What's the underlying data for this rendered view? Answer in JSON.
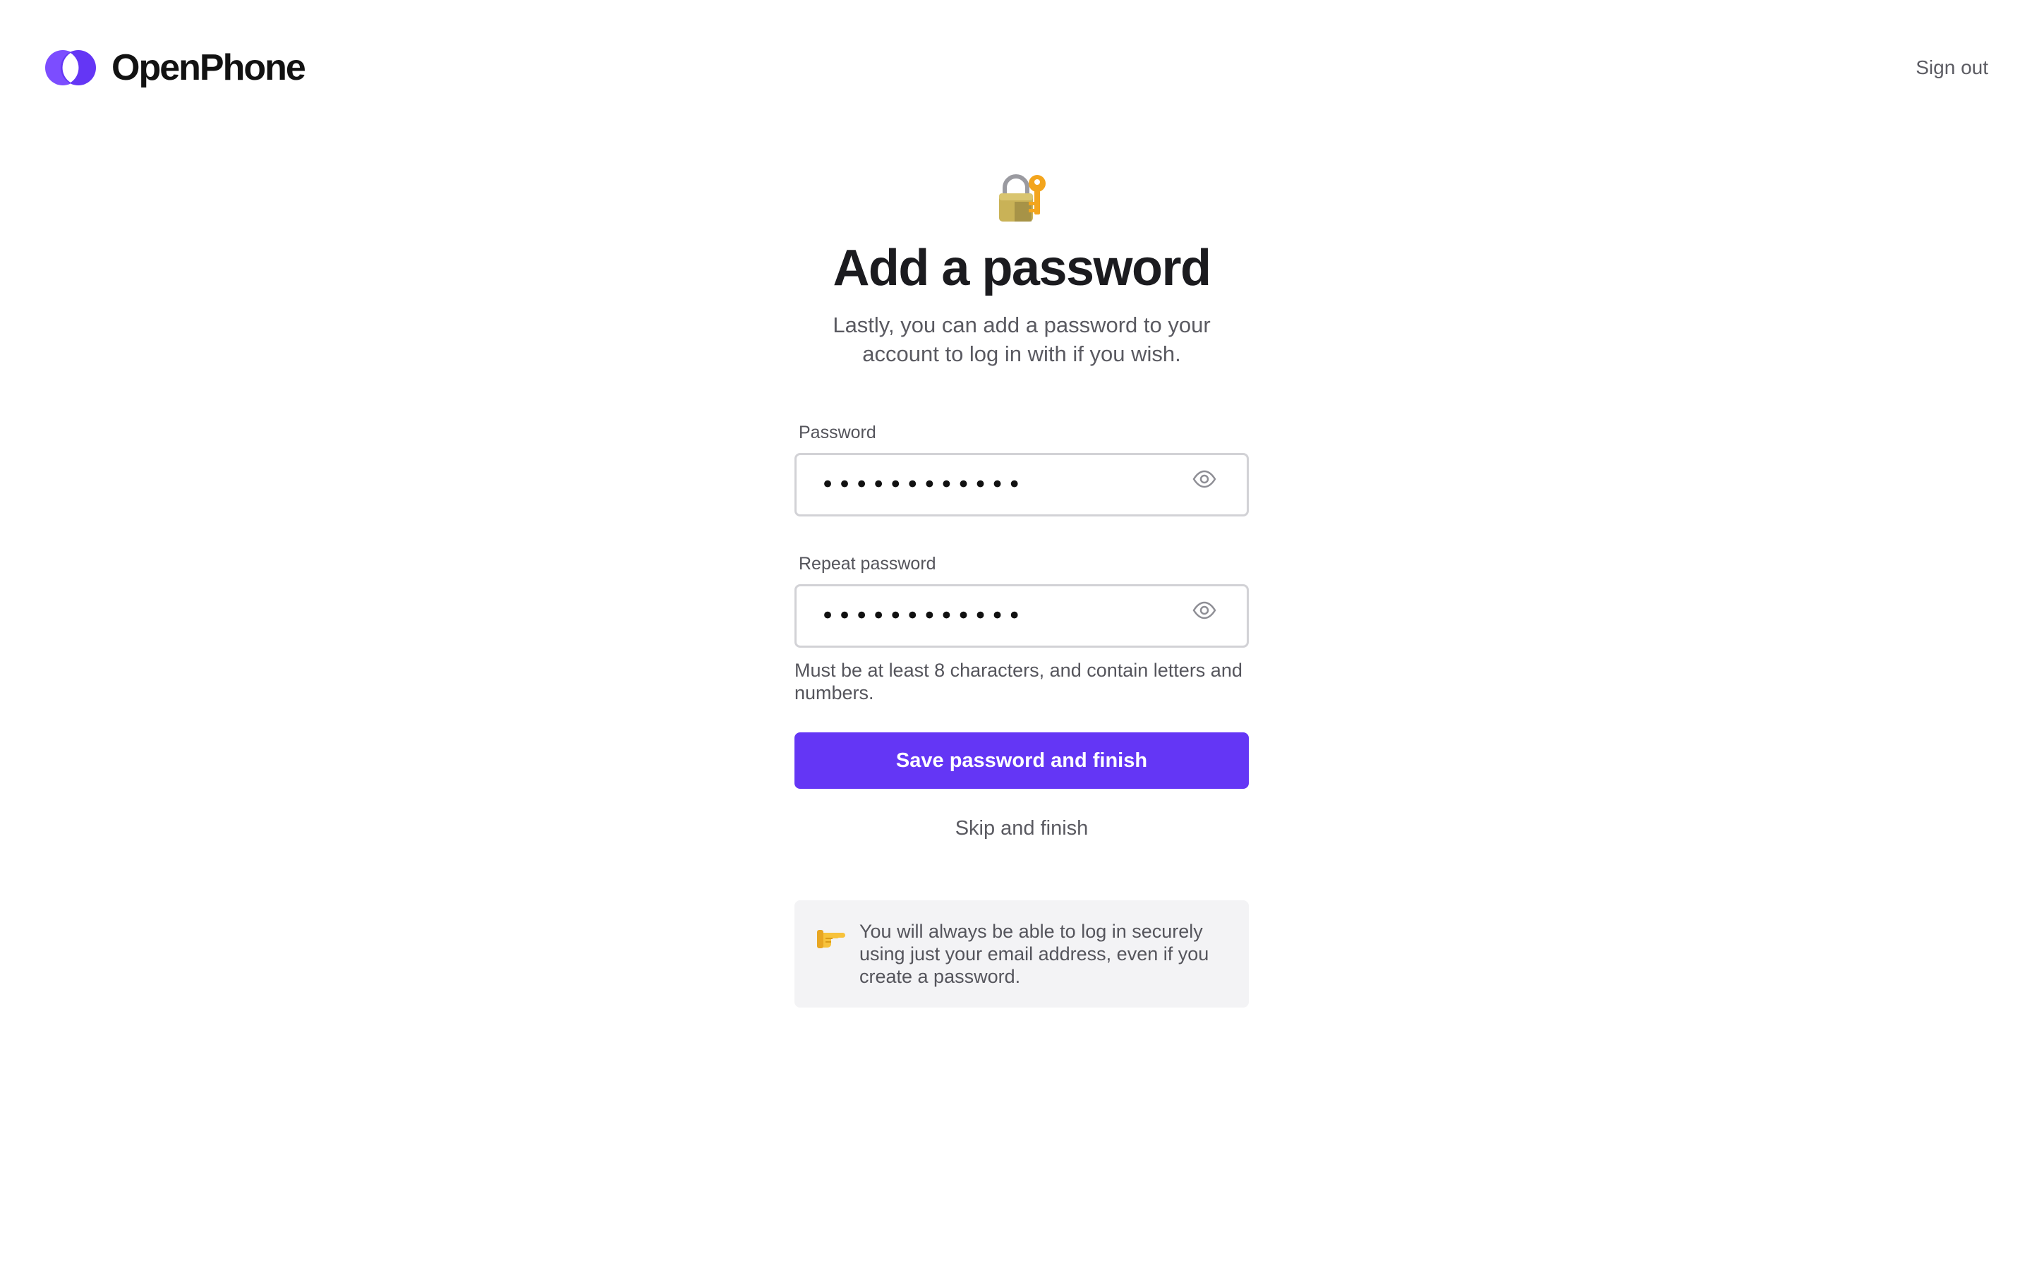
{
  "brand": {
    "name": "OpenPhone",
    "color": "#6436f5",
    "logo_icon": "openphone-logo-icon"
  },
  "header": {
    "sign_out_label": "Sign out"
  },
  "main": {
    "hero_icon": "locked-with-key-icon",
    "title": "Add a password",
    "subtitle": "Lastly, you can add a password to your account to log in with if you wish.",
    "password": {
      "label": "Password",
      "value": "••••••••••••",
      "toggle_icon": "eye-icon"
    },
    "repeat_password": {
      "label": "Repeat password",
      "value": "••••••••••••",
      "toggle_icon": "eye-icon"
    },
    "hint": "Must be at least 8 characters, and contain letters and numbers.",
    "primary_button_label": "Save password and finish",
    "skip_label": "Skip and finish",
    "note": {
      "icon": "pointing-hand-icon",
      "text": "You will always be able to log in securely using just your email address, even if you create a password."
    }
  }
}
